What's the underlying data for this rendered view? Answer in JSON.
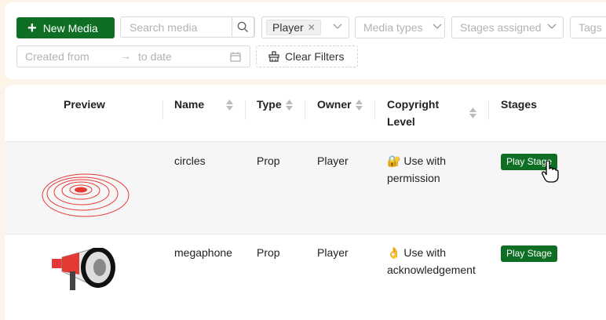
{
  "toolbar": {
    "new_media_label": "New Media",
    "search_placeholder": "Search media",
    "owner_filter_tag": "Player",
    "media_types_placeholder": "Media types",
    "stages_placeholder": "Stages assigned",
    "tags_placeholder": "Tags",
    "date_from_placeholder": "Created from",
    "date_to_placeholder": "to date",
    "clear_filters_label": "Clear Filters"
  },
  "table": {
    "columns": [
      "Preview",
      "Name",
      "Type",
      "Owner",
      "Copyright",
      "Level",
      "Stages"
    ],
    "rows": [
      {
        "name": "circles",
        "type": "Prop",
        "owner": "Player",
        "copyright_emoji": "🔐",
        "copyright_line1": "Use with",
        "copyright_line2": "permission",
        "stage": "Play Stage",
        "preview_icon": "circles-preview"
      },
      {
        "name": "megaphone",
        "type": "Prop",
        "owner": "Player",
        "copyright_emoji": "👌",
        "copyright_line1": "Use with",
        "copyright_line2": "acknowledgement",
        "stage": "Play Stage",
        "preview_icon": "megaphone-preview"
      }
    ]
  },
  "colors": {
    "primary": "#0d6e24",
    "page_bg": "#fdf3e8",
    "row_highlight": "#f6f6f6"
  }
}
